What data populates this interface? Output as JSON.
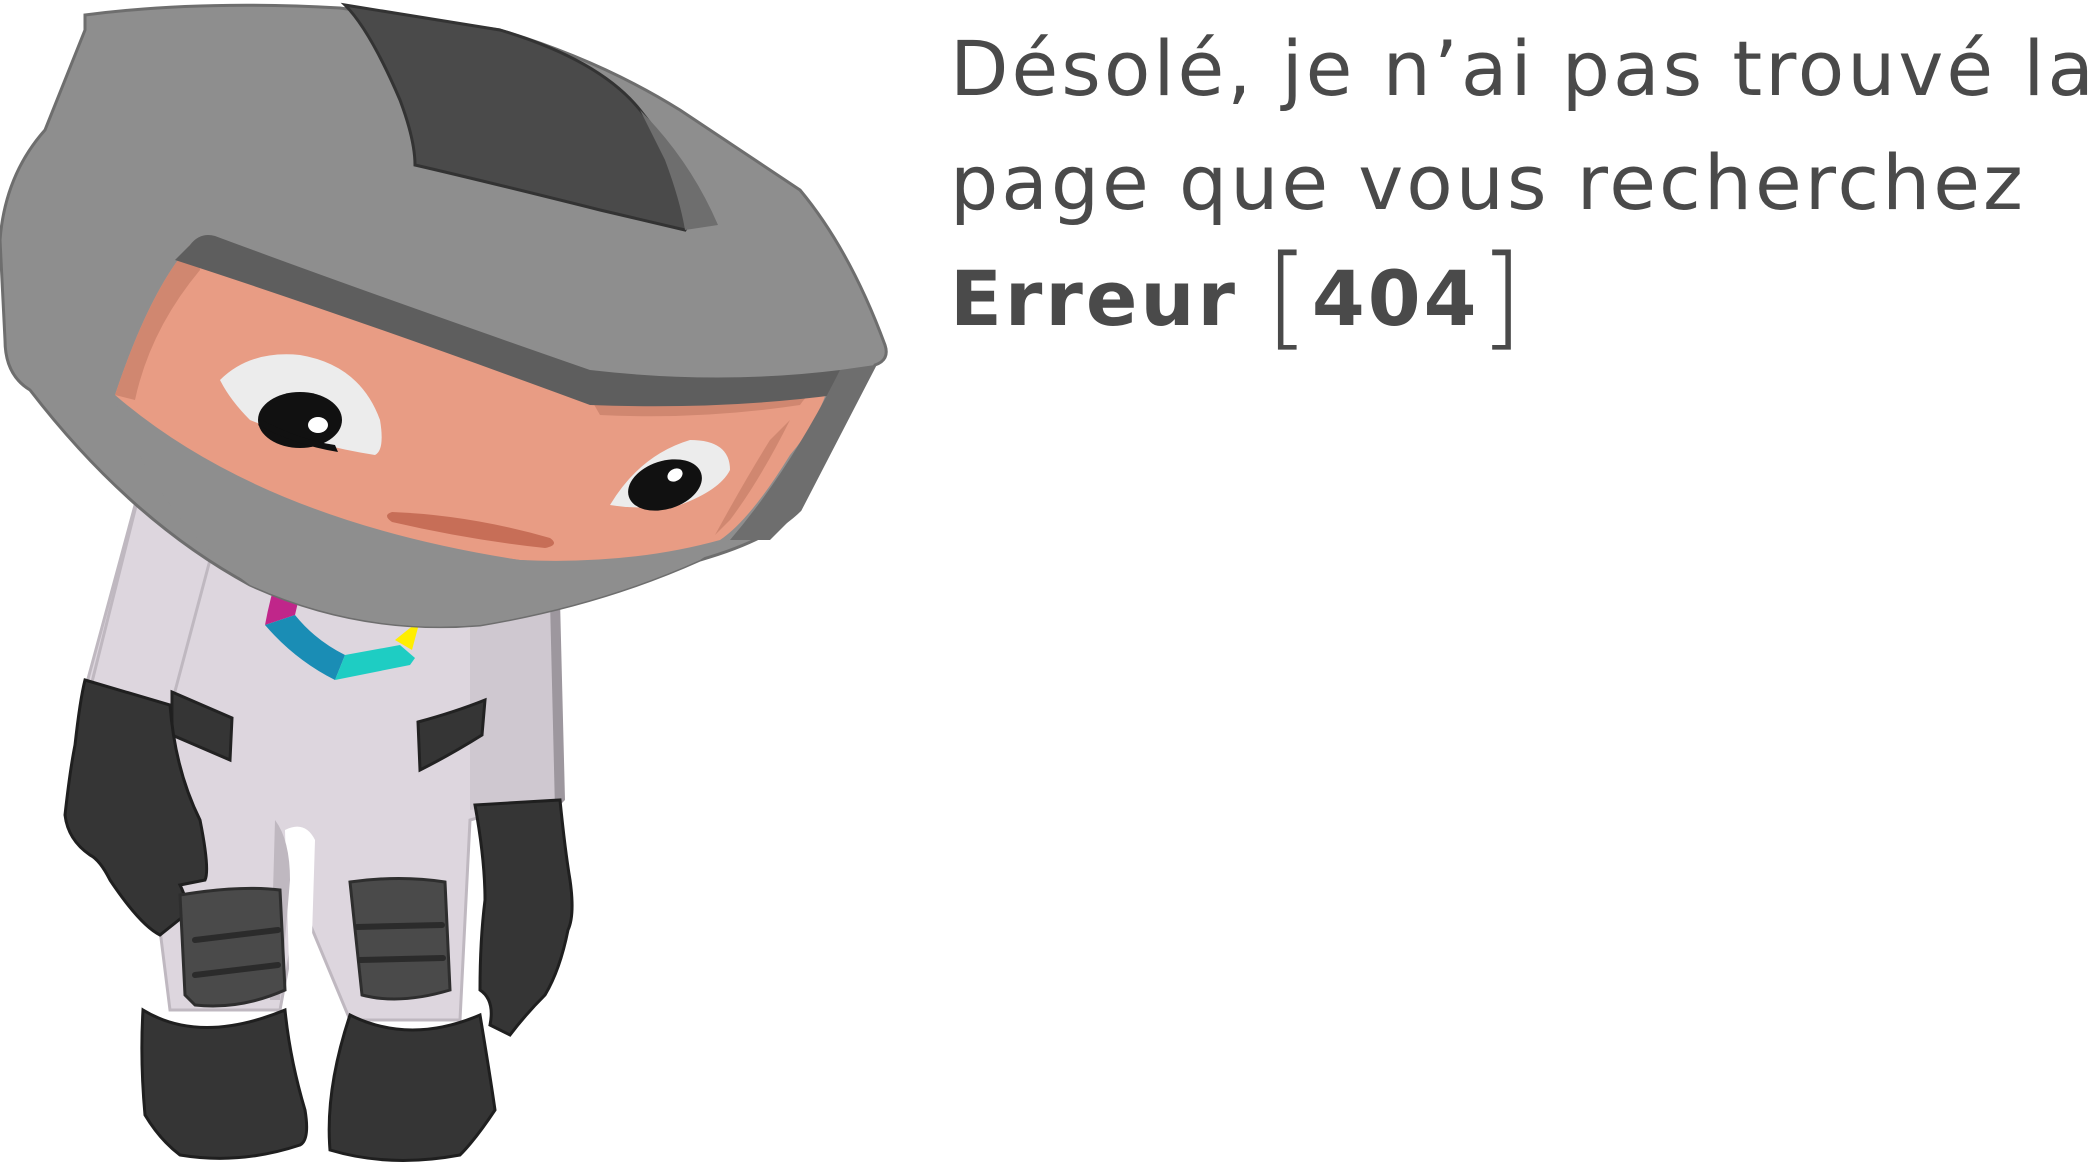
{
  "message": {
    "line1": "Désolé, je n’ai pas trouvé la",
    "line2": "page que vous recherchez"
  },
  "error": {
    "label": "Erreur",
    "open_bracket": "[",
    "code": "404",
    "close_bracket": "]"
  },
  "illustration": {
    "name": "sad-astronaut-mascot",
    "colors": {
      "helmet": "#8e8e8e",
      "helmet_dark": "#4a4a4a",
      "face": "#e89c84",
      "suit": "#ddd6de",
      "gloves_boots": "#353535",
      "logo_magenta": "#c0268a",
      "logo_blue": "#1a8db5",
      "logo_teal": "#1ecdc3",
      "logo_yellow": "#ffee00",
      "logo_orange": "#f7931e"
    }
  }
}
